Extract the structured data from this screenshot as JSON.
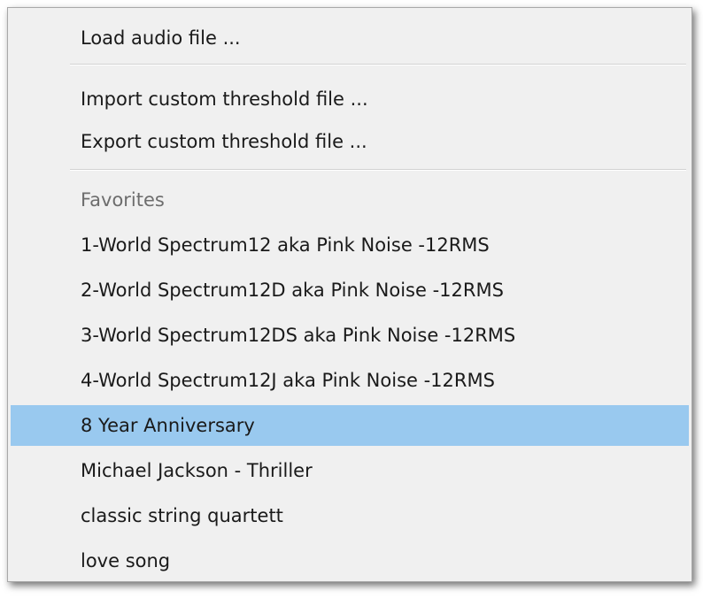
{
  "menu": {
    "load_audio": "Load audio file ...",
    "import_threshold": "Import custom threshold file ...",
    "export_threshold": "Export custom threshold file ...",
    "favorites_header": "Favorites",
    "favorites": [
      "1-World Spectrum12 aka Pink Noise -12RMS",
      "2-World Spectrum12D aka Pink Noise -12RMS",
      "3-World Spectrum12DS aka Pink Noise -12RMS",
      "4-World Spectrum12J aka Pink Noise -12RMS",
      "8 Year Anniversary",
      "Michael Jackson - Thriller",
      "classic string quartett",
      "love song"
    ],
    "selected_item": "8 Year Anniversary"
  },
  "colors": {
    "menu_background": "#f0f0f0",
    "highlight": "#99c9ef",
    "header_text": "#6d6d6d"
  }
}
